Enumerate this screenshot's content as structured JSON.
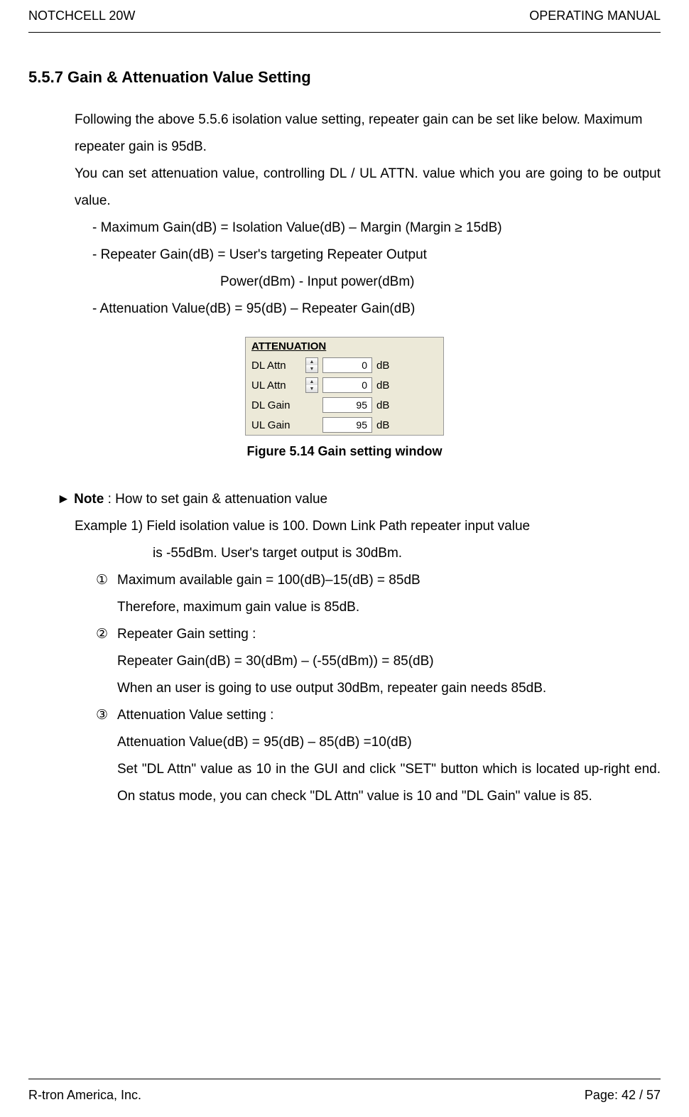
{
  "header": {
    "left": "NOTCHCELL 20W",
    "right": "OPERATING MANUAL"
  },
  "section": {
    "number_title": "5.5.7 Gain & Attenuation Value Setting",
    "para1": "Following the above 5.5.6 isolation value setting, repeater gain can be set like below. Maximum repeater gain is 95dB.",
    "para2": "You can set attenuation value, controlling DL / UL ATTN. value which you are going to be output value.",
    "bullet1": "-  Maximum Gain(dB) = Isolation Value(dB) – Margin (Margin ≥ 15dB)",
    "bullet2": "-  Repeater Gain(dB) = User's targeting Repeater Output",
    "bullet2_cont": "Power(dBm) - Input power(dBm)",
    "bullet3": "-    Attenuation Value(dB) = 95(dB) – Repeater Gain(dB)"
  },
  "attn_window": {
    "title": "ATTENUATION",
    "rows": [
      {
        "label": "DL Attn",
        "value": "0",
        "unit": "dB",
        "hasSpinner": true
      },
      {
        "label": "UL Attn",
        "value": "0",
        "unit": "dB",
        "hasSpinner": true
      },
      {
        "label": "DL Gain",
        "value": "95",
        "unit": "dB",
        "hasSpinner": false
      },
      {
        "label": "UL Gain",
        "value": "95",
        "unit": "dB",
        "hasSpinner": false
      }
    ]
  },
  "figure_caption": "Figure 5.14 Gain setting window",
  "note": {
    "title_prefix": "► ",
    "title_bold": "Note",
    "title_rest": " : How to set gain & attenuation value",
    "example_line": "Example 1) Field isolation value is 100. Down Link Path repeater input value",
    "example_cont": "is -55dBm. User's target output is 30dBm.",
    "items": [
      {
        "num": "①",
        "first": "Maximum available gain = 100(dB)–15(dB) = 85dB",
        "subs": [
          "Therefore, maximum gain value is 85dB."
        ]
      },
      {
        "num": "②",
        "first": "Repeater Gain setting :",
        "subs": [
          "Repeater Gain(dB) = 30(dBm) – (-55(dBm)) = 85(dB)",
          "When an user is going to use output 30dBm, repeater gain needs 85dB."
        ]
      },
      {
        "num": "③",
        "first": "Attenuation Value setting :",
        "subs": [
          "Attenuation Value(dB) = 95(dB) – 85(dB) =10(dB)",
          "Set \"DL Attn\" value as 10 in the GUI and click \"SET\" button which is located up-right end.   On status mode, you can check \"DL Attn\" value is 10 and \"DL Gain\" value is 85."
        ]
      }
    ]
  },
  "footer": {
    "left": "R-tron America, Inc.",
    "right": "Page: 42 / 57"
  }
}
